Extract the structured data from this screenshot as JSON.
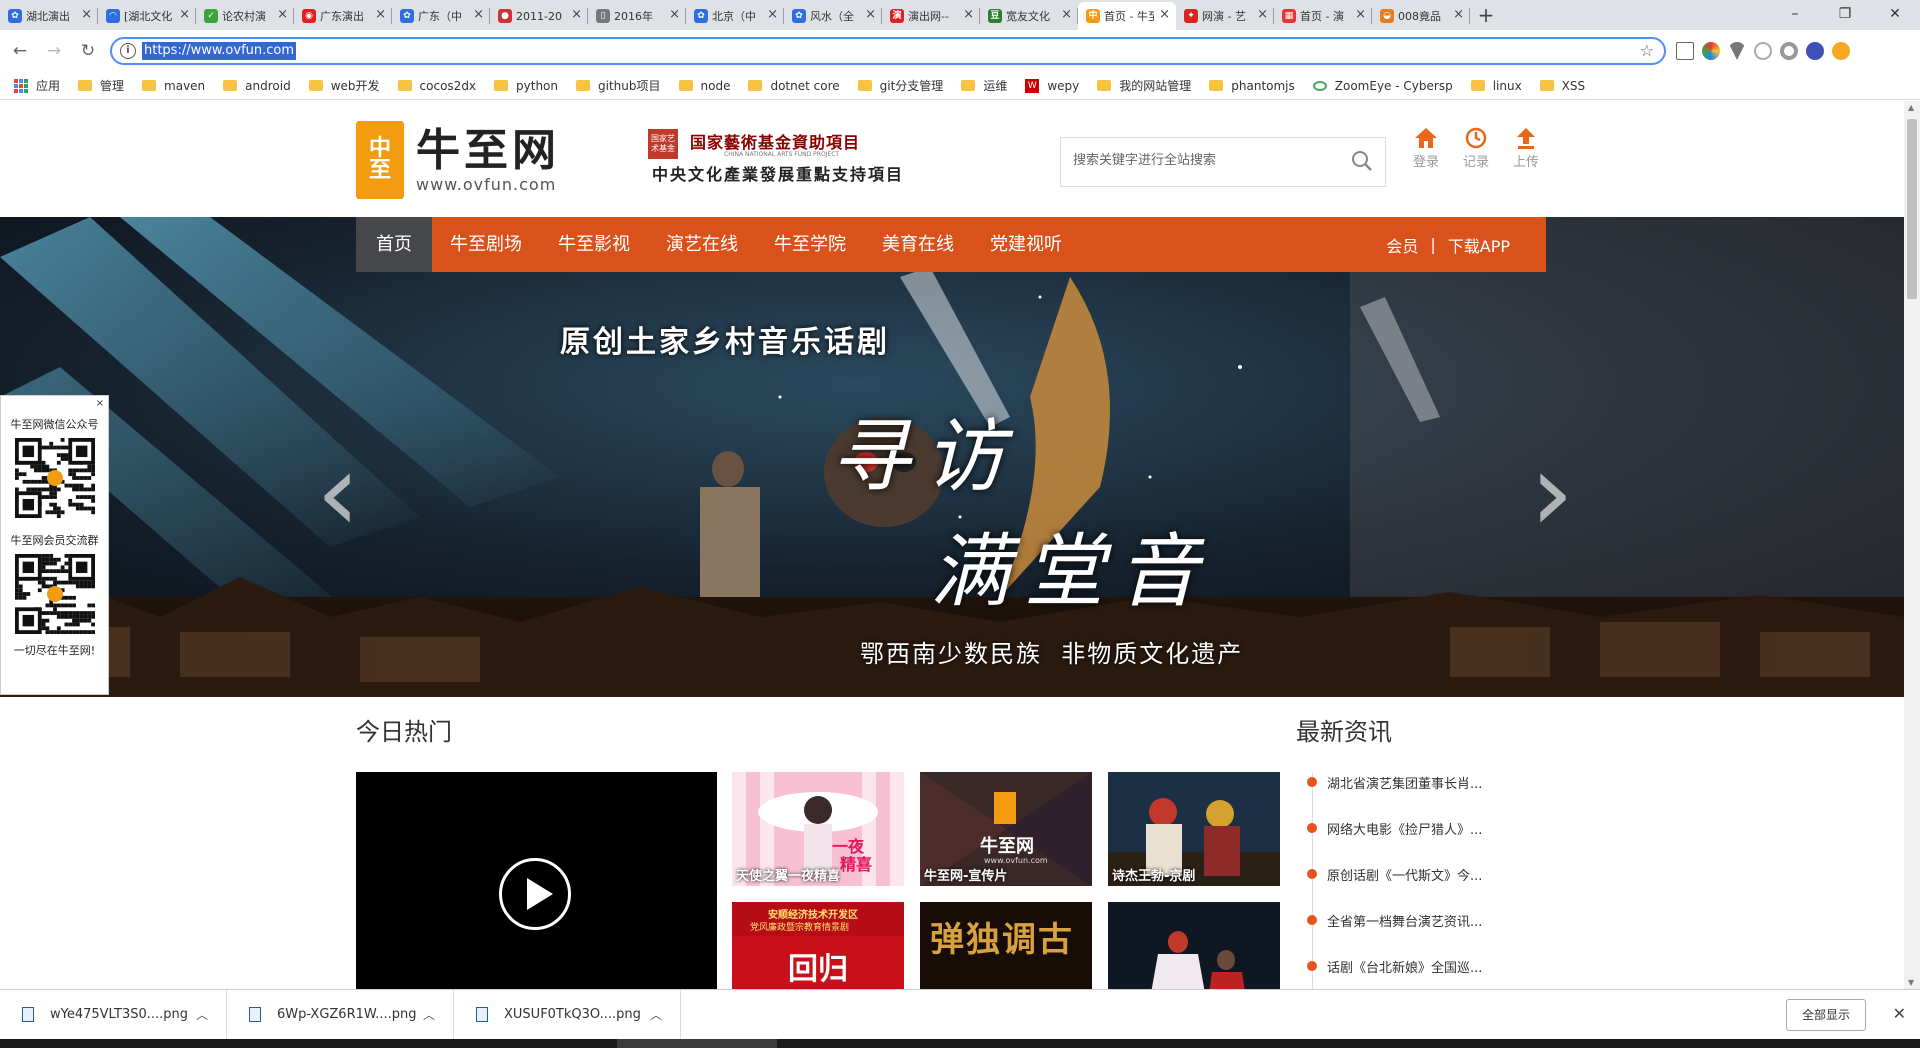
{
  "browser": {
    "tabs": [
      {
        "title": "湖北演出",
        "fav": "paw",
        "color": "#2d6fe0"
      },
      {
        "title": "[湖北文化",
        "fav": "spinner",
        "color": "#2d6fe0"
      },
      {
        "title": "论农村演",
        "fav": "leaf",
        "color": "#3aa43a"
      },
      {
        "title": "广东演出",
        "fav": "weibo",
        "color": "#e02020"
      },
      {
        "title": "广东（中",
        "fav": "paw",
        "color": "#2d6fe0"
      },
      {
        "title": "2011-20",
        "fav": "globe",
        "color": "#c33"
      },
      {
        "title": "2016年",
        "fav": "doc",
        "color": "#777"
      },
      {
        "title": "北京（中",
        "fav": "paw",
        "color": "#2d6fe0"
      },
      {
        "title": "风水（全",
        "fav": "paw",
        "color": "#2d6fe0"
      },
      {
        "title": "演出网--",
        "fav": "yan",
        "color": "#d22"
      },
      {
        "title": "宽友文化",
        "fav": "dou",
        "color": "#2e7d32"
      },
      {
        "title": "首页 - 牛至",
        "fav": "ovfun",
        "color": "#f39c12"
      },
      {
        "title": "网演 - 艺",
        "fav": "flag",
        "color": "#d22"
      },
      {
        "title": "首页 - 演",
        "fav": "grid",
        "color": "#e53935"
      },
      {
        "title": "008竟品",
        "fav": "bowl",
        "color": "#e67e22"
      }
    ],
    "active_tab_index": 11,
    "new_tab": "+",
    "window_controls": [
      "–",
      "❐",
      "✕"
    ],
    "url": "https://www.ovfun.com",
    "bookmarks": [
      {
        "label": "应用",
        "icon": "apps-grid"
      },
      {
        "label": "管理",
        "icon": "folder"
      },
      {
        "label": "maven",
        "icon": "folder"
      },
      {
        "label": "android",
        "icon": "folder"
      },
      {
        "label": "web开发",
        "icon": "folder"
      },
      {
        "label": "cocos2dx",
        "icon": "folder"
      },
      {
        "label": "python",
        "icon": "folder"
      },
      {
        "label": "github项目",
        "icon": "folder"
      },
      {
        "label": "node",
        "icon": "folder"
      },
      {
        "label": "dotnet core",
        "icon": "folder"
      },
      {
        "label": "git分支管理",
        "icon": "folder"
      },
      {
        "label": "运维",
        "icon": "folder"
      },
      {
        "label": "wepy",
        "icon": "red-box"
      },
      {
        "label": "我的网站管理",
        "icon": "folder"
      },
      {
        "label": "phantomjs",
        "icon": "folder"
      },
      {
        "label": "ZoomEye - Cybersp",
        "icon": "eye"
      },
      {
        "label": "linux",
        "icon": "folder"
      },
      {
        "label": "XSS",
        "icon": "folder"
      }
    ]
  },
  "site": {
    "logo_mark_chars": [
      "中",
      "至"
    ],
    "logo_cn": "牛至网",
    "logo_en": "www.ovfun.com",
    "fund_seal": "国家艺术基金",
    "fund_line1": "国家藝術基金資助項目",
    "fund_line1_sub": "CHINA NATIONAL ARTS FUND PROJECT",
    "fund_line2": "中央文化產業發展重點支持項目",
    "search_placeholder": "搜索关键字进行全站搜索",
    "header_icons": [
      {
        "label": "登录",
        "icon": "home-icon"
      },
      {
        "label": "记录",
        "icon": "clock-icon"
      },
      {
        "label": "上传",
        "icon": "upload-icon"
      }
    ],
    "nav": {
      "items": [
        "首页",
        "牛至剧场",
        "牛至影视",
        "演艺在线",
        "牛至学院",
        "美育在线",
        "党建视听"
      ],
      "active_index": 0,
      "member": "会员",
      "sep": "|",
      "download": "下载APP"
    },
    "banner": {
      "subtitle": "原创土家乡村音乐话剧",
      "title_line1": "寻访",
      "title_line2": "满堂音",
      "caption": "鄂西南少数民族  非物质文化遗产",
      "prev": "‹",
      "next": "›"
    },
    "qr_panel": {
      "close": "×",
      "title1": "牛至网微信公众号",
      "title2": "牛至网会员交流群",
      "footer": "一切尽在牛至网!"
    },
    "hot": {
      "title": "今日热门",
      "thumbs": [
        {
          "caption": "天使之翼一夜精喜",
          "bg": "#f5b3c8"
        },
        {
          "caption": "牛至网-宣传片",
          "bg": "#3a2a2a"
        },
        {
          "caption": "诗杰王勃-京剧",
          "bg": "#1c2a3a"
        },
        {
          "caption": "",
          "bg": "#c8101a"
        },
        {
          "caption": "",
          "bg": "#1a0e08"
        },
        {
          "caption": "",
          "bg": "#101820"
        }
      ],
      "thumb2_logo_cn": "牛至网",
      "thumb2_logo_en": "www.ovfun.com",
      "thumb4_text": "安顺经济技术开发区",
      "thumb4_sub": "党风廉政暨宗教育情景剧",
      "thumb4_big": "回归",
      "thumb5_text": "弹独调古"
    },
    "news": {
      "title": "最新资讯",
      "items": [
        "湖北省演艺集团董事长肖...",
        "网络大电影《捡尸猎人》...",
        "原创话剧《一代斯文》今...",
        "全省第一档舞台演艺资讯...",
        "话剧《台北新娘》全国巡..."
      ]
    }
  },
  "downloads": {
    "files": [
      "wYe475VLT3S0....png",
      "6Wp-XGZ6R1W....png",
      "XUSUF0TkQ3O....png"
    ],
    "show_all": "全部显示",
    "close": "✕"
  }
}
